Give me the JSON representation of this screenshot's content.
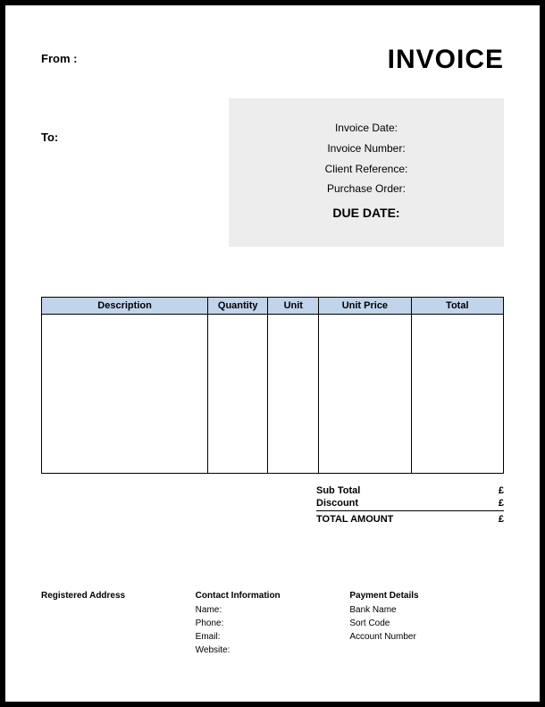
{
  "header": {
    "from_label": "From :",
    "title": "INVOICE",
    "to_label": "To:"
  },
  "meta": {
    "invoice_date_label": "Invoice Date:",
    "invoice_number_label": "Invoice Number:",
    "client_reference_label": "Client Reference:",
    "purchase_order_label": "Purchase Order:",
    "due_date_label": "DUE DATE:"
  },
  "table": {
    "headers": {
      "description": "Description",
      "quantity": "Quantity",
      "unit": "Unit",
      "unit_price": "Unit Price",
      "total": "Total"
    }
  },
  "totals": {
    "sub_total_label": "Sub Total",
    "sub_total_value": "£",
    "discount_label": "Discount",
    "discount_value": "£",
    "total_amount_label": "TOTAL AMOUNT",
    "total_amount_value": "£"
  },
  "footer": {
    "registered": {
      "heading": "Registered Address"
    },
    "contact": {
      "heading": "Contact Information",
      "name": "Name:",
      "phone": "Phone:",
      "email": "Email:",
      "website": "Website:"
    },
    "payment": {
      "heading": "Payment Details",
      "bank": "Bank Name",
      "sort": "Sort Code",
      "account": "Account Number"
    }
  }
}
